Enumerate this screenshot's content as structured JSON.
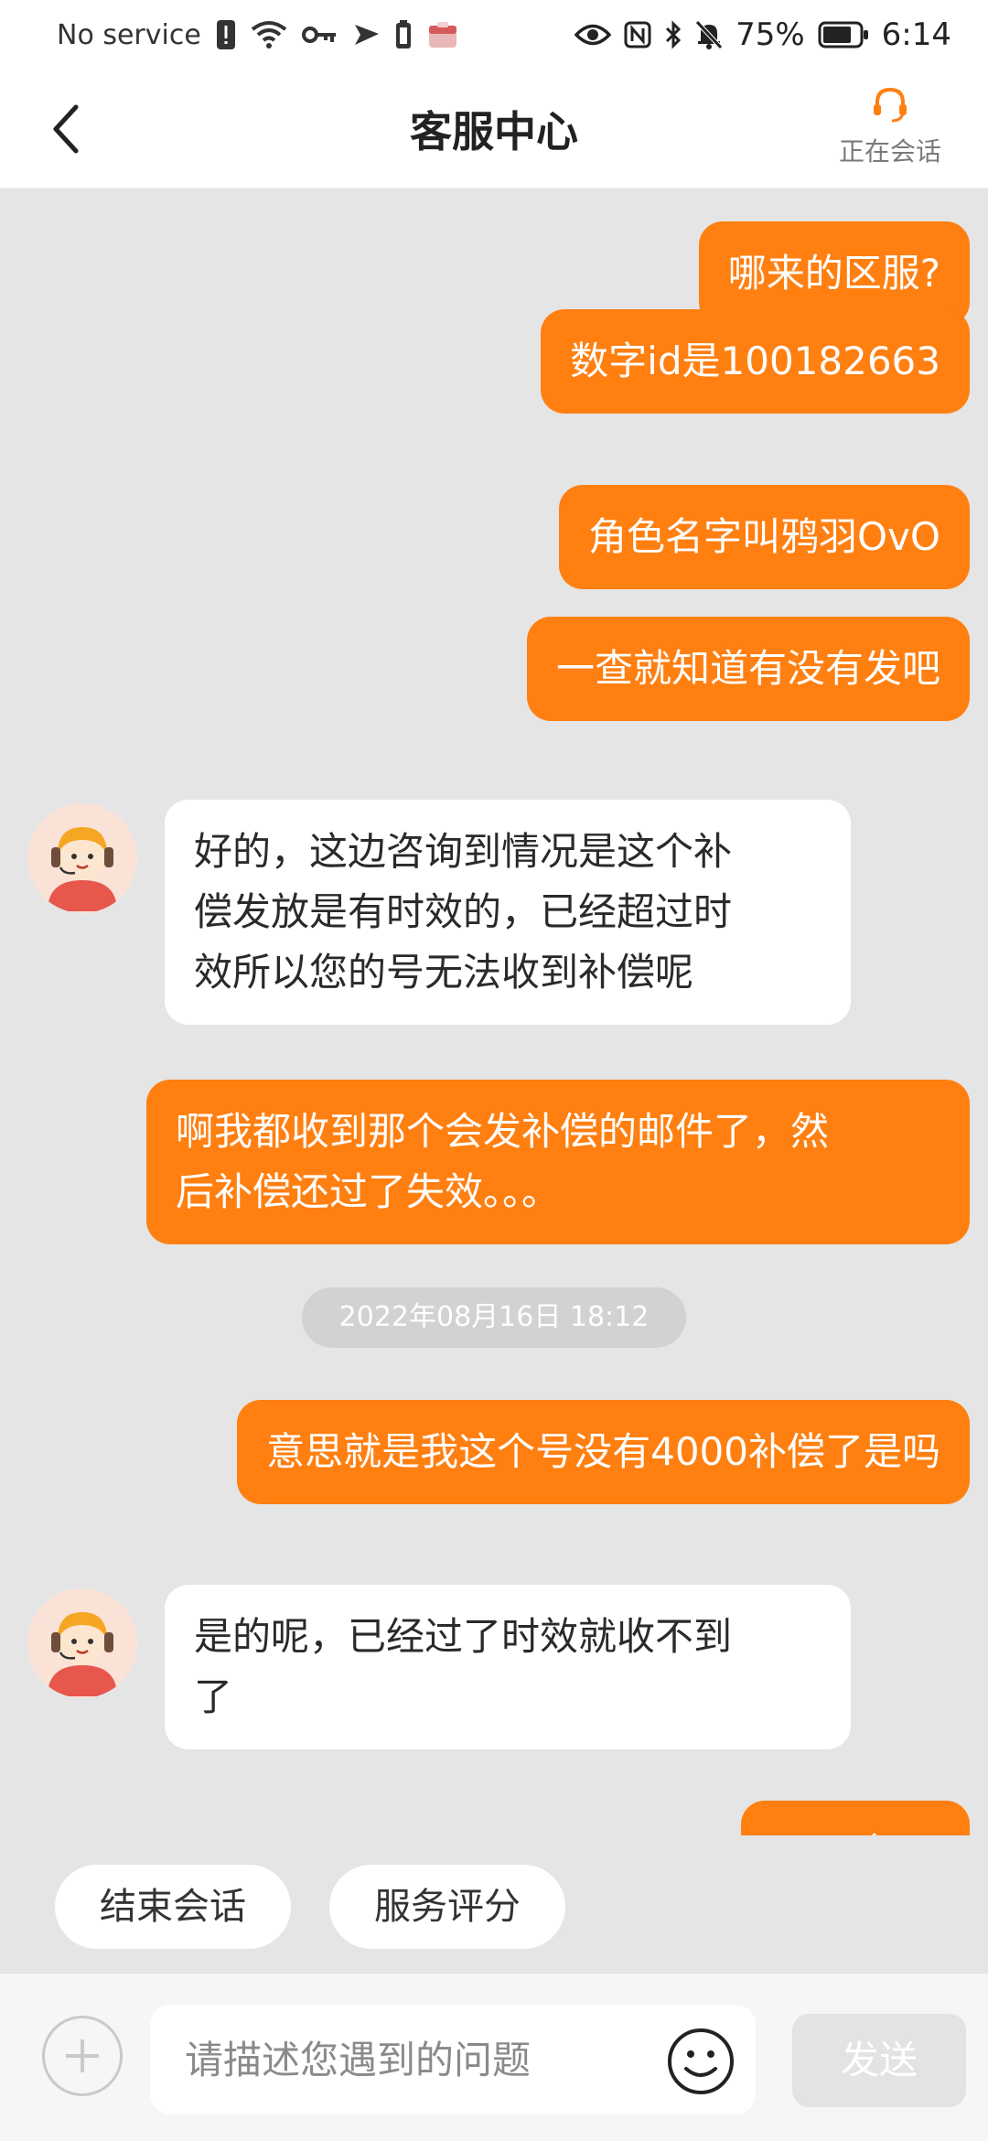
{
  "status_bar": {
    "carrier": "No service",
    "battery": "75%",
    "time": "6:14"
  },
  "header": {
    "title": "客服中心",
    "session_label": "正在会话"
  },
  "colors": {
    "accent": "#ff7f11",
    "chat_background": "#e5e5e5",
    "agent_bubble": "#ffffff"
  },
  "messages": [
    {
      "from": "user",
      "text": "哪来的区服?"
    },
    {
      "from": "user",
      "text": "数字id是100182663"
    },
    {
      "from": "user",
      "text": "角色名字叫鸦羽OvO"
    },
    {
      "from": "user",
      "text": "一查就知道有没有发吧"
    },
    {
      "from": "agent",
      "line1": "好的，这边咨询到情况是这个补",
      "line2": "偿发放是有时效的，已经超过时",
      "line3": "效所以您的号无法收到补偿呢"
    },
    {
      "from": "user",
      "line1": "啊我都收到那个会发补偿的邮件了，然",
      "line2": "后补偿还过了失效。。。"
    },
    {
      "from": "user",
      "text": "意思就是我这个号没有4000补偿了是吗"
    },
    {
      "from": "agent",
      "line1": "是的呢，已经过了时效就收不到",
      "line2": "了"
    },
    {
      "from": "user",
      "text": "行吧"
    }
  ],
  "timestamp": "2022年08月16日 18:12",
  "quick_actions": [
    "结束会话",
    "服务评分"
  ],
  "input": {
    "placeholder": "请描述您遇到的问题",
    "send_label": "发送"
  }
}
